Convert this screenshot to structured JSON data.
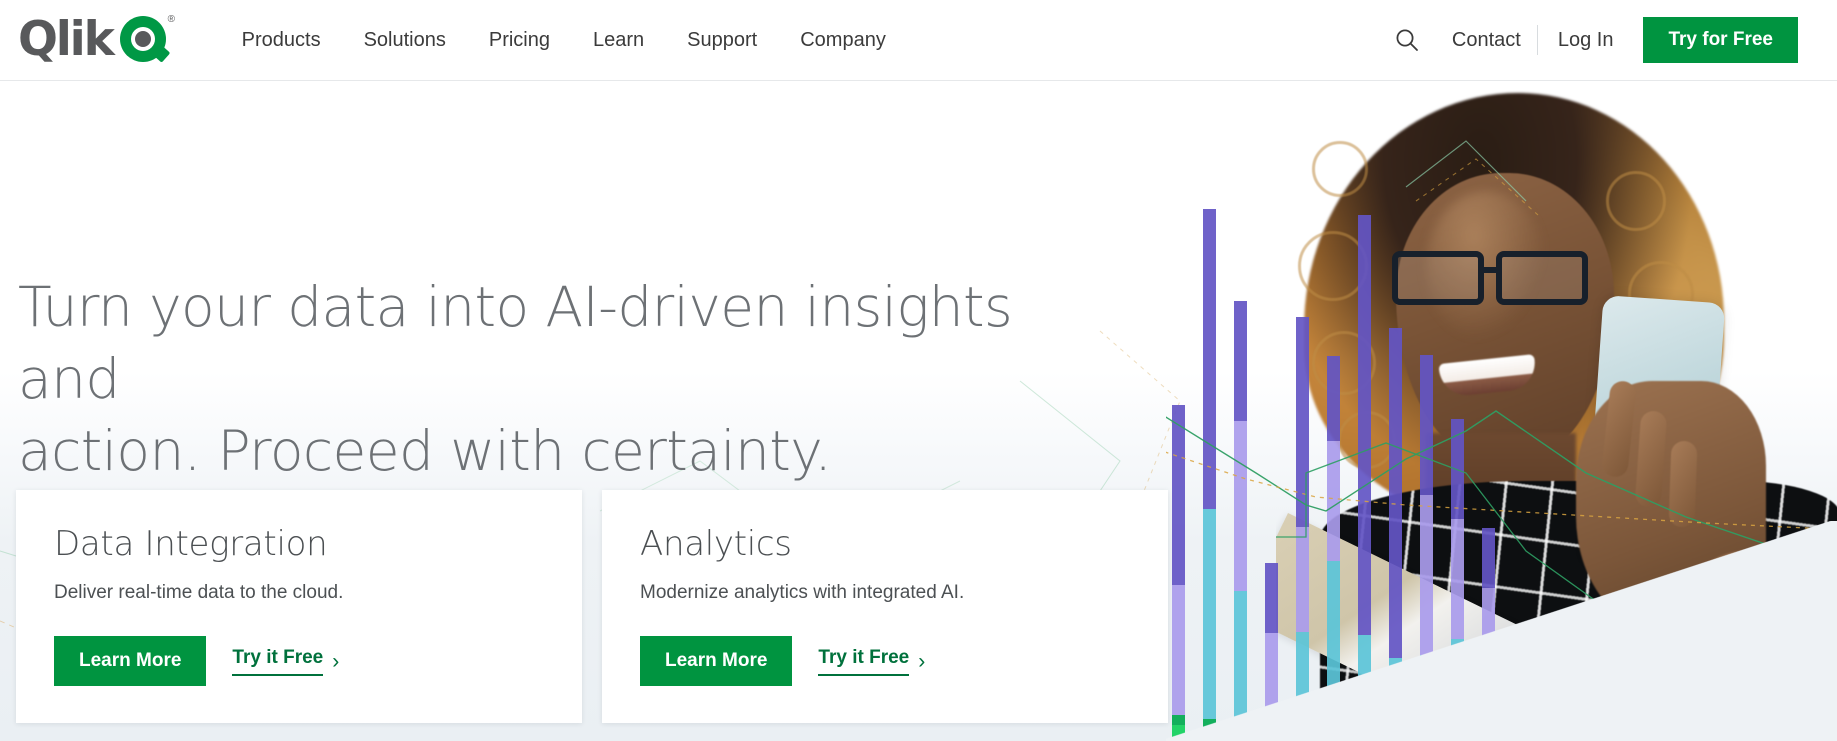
{
  "brand": {
    "logo_text": "Qlik",
    "logo_mark": "q-logo-icon",
    "registered_mark": "®",
    "green": "#009845",
    "button_green": "#009440",
    "link_green": "#00713C",
    "gray_text": "#58595B"
  },
  "nav": {
    "items": [
      {
        "label": "Products"
      },
      {
        "label": "Solutions"
      },
      {
        "label": "Pricing"
      },
      {
        "label": "Learn"
      },
      {
        "label": "Support"
      },
      {
        "label": "Company"
      }
    ],
    "search_icon": "search-icon",
    "contact_label": "Contact",
    "login_label": "Log In",
    "cta_label": "Try for Free"
  },
  "hero": {
    "headline_line1": "Turn your data into AI-driven insights and",
    "headline_line2": "action. Proceed with certainty.",
    "image_alt": "woman-with-phone-photo"
  },
  "cards": [
    {
      "title": "Data Integration",
      "subtitle": "Deliver real-time data to the cloud.",
      "primary_label": "Learn More",
      "secondary_label": "Try it Free",
      "chevron": "›"
    },
    {
      "title": "Analytics",
      "subtitle": "Modernize analytics with integrated AI.",
      "primary_label": "Learn More",
      "secondary_label": "Try it Free",
      "chevron": "›"
    }
  ],
  "chart_data": {
    "type": "bar",
    "title": "",
    "note": "decorative stacked bar chart overlaying hero photo",
    "colors": {
      "dark_purple": "#6355C4",
      "light_purple": "#A99BEC",
      "cyan": "#5BC4D8",
      "green": "#00A94F",
      "bright_green": "#23D368",
      "line_green": "#2E9E63",
      "line_orange": "#D9A441"
    },
    "categories": [
      "b1",
      "b2",
      "b3",
      "b4",
      "b5",
      "b6",
      "b7",
      "b8",
      "b9",
      "b10",
      "b11"
    ],
    "series": [
      {
        "name": "dark_purple",
        "values": [
          180,
          300,
          120,
          70,
          210,
          85,
          420,
          330,
          140,
          100,
          60
        ]
      },
      {
        "name": "light_purple",
        "values": [
          130,
          0,
          170,
          90,
          105,
          120,
          0,
          0,
          160,
          120,
          95
        ]
      },
      {
        "name": "cyan",
        "values": [
          0,
          210,
          150,
          0,
          95,
          160,
          60,
          55,
          70,
          90,
          40
        ]
      },
      {
        "name": "green",
        "values": [
          26,
          22,
          0,
          18,
          14,
          20,
          46,
          28,
          16,
          12,
          18
        ]
      }
    ],
    "grid": false,
    "legend": "none"
  }
}
